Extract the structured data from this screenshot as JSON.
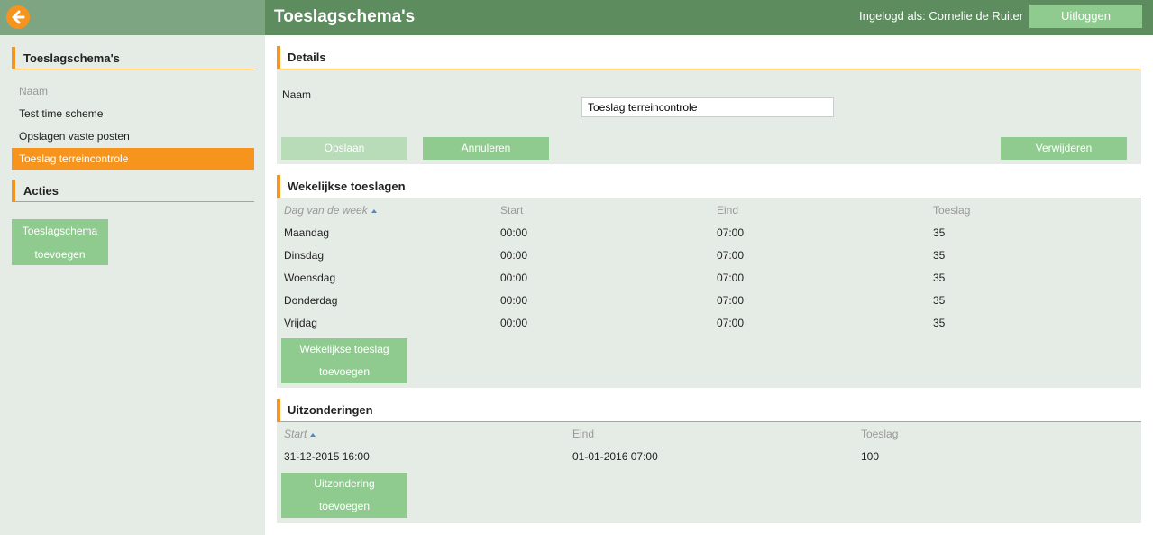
{
  "header": {
    "title": "Toeslagschema's",
    "login_label": "Ingelogd als: Cornelie de Ruiter",
    "logout_label": "Uitloggen"
  },
  "sidebar": {
    "title": "Toeslagschema's",
    "items": [
      {
        "label": "Naam"
      },
      {
        "label": "Test time scheme"
      },
      {
        "label": "Opslagen vaste posten"
      },
      {
        "label": "Toeslag terreincontrole"
      }
    ],
    "actions_title": "Acties",
    "action_button_line1": "Toeslagschema",
    "action_button_line2": "toevoegen"
  },
  "details": {
    "title": "Details",
    "name_label": "Naam",
    "name_value": "Toeslag terreincontrole",
    "save_label": "Opslaan",
    "cancel_label": "Annuleren",
    "delete_label": "Verwijderen"
  },
  "weekly": {
    "title": "Wekelijkse toeslagen",
    "headers": [
      "Dag van de week",
      "Start",
      "Eind",
      "Toeslag"
    ],
    "rows": [
      [
        "Maandag",
        "00:00",
        "07:00",
        "35"
      ],
      [
        "Dinsdag",
        "00:00",
        "07:00",
        "35"
      ],
      [
        "Woensdag",
        "00:00",
        "07:00",
        "35"
      ],
      [
        "Donderdag",
        "00:00",
        "07:00",
        "35"
      ],
      [
        "Vrijdag",
        "00:00",
        "07:00",
        "35"
      ]
    ],
    "add_line1": "Wekelijkse toeslag",
    "add_line2": "toevoegen"
  },
  "exceptions": {
    "title": "Uitzonderingen",
    "headers": [
      "Start",
      "Eind",
      "Toeslag"
    ],
    "rows": [
      [
        "31-12-2015 16:00",
        "01-01-2016 07:00",
        "100"
      ]
    ],
    "add_line1": "Uitzondering",
    "add_line2": "toevoegen"
  },
  "colors": {
    "accent": "#f7941d",
    "header_green": "#5d8c5f",
    "button_green": "#8fcb8f",
    "panel_bg": "#e5ece6"
  }
}
